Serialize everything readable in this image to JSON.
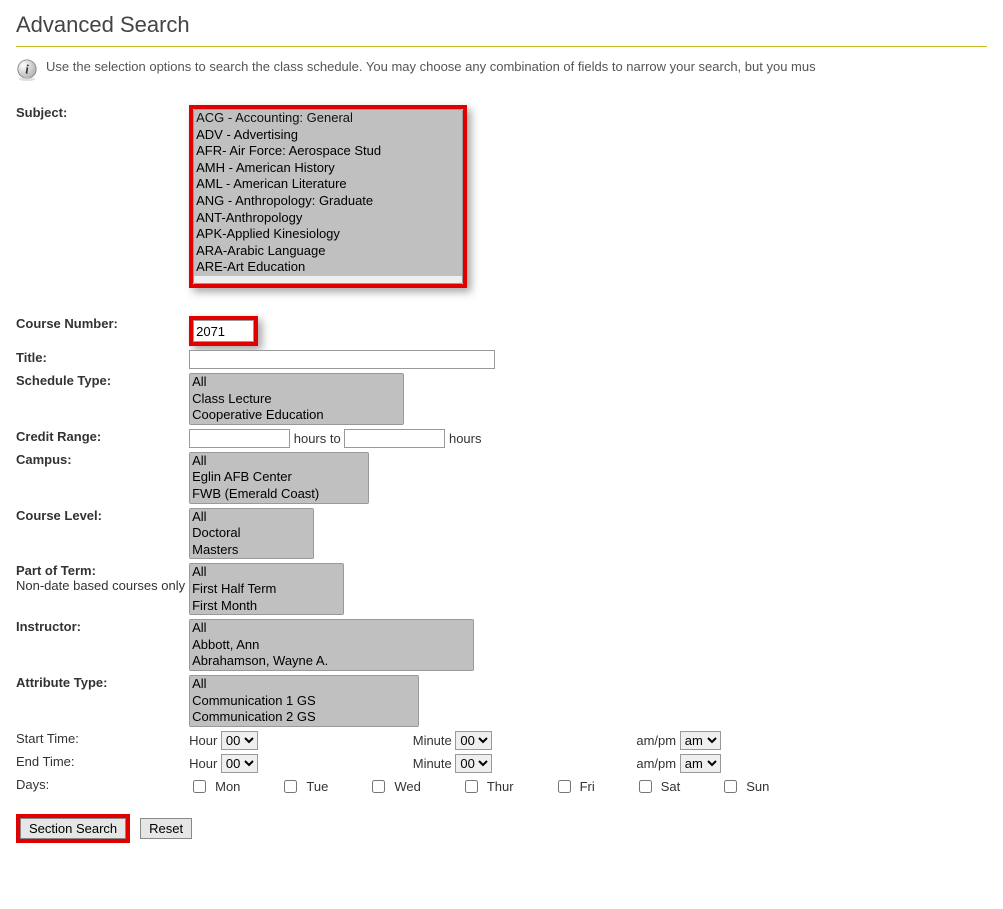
{
  "page": {
    "title": "Advanced Search",
    "info_text": "Use the selection options to search the class schedule. You may choose any combination of fields to narrow your search, but you mus"
  },
  "labels": {
    "subject": "Subject:",
    "course_number": "Course Number:",
    "title": "Title:",
    "schedule_type": "Schedule Type:",
    "credit_range": "Credit Range:",
    "hours_to": "hours to",
    "hours": "hours",
    "campus": "Campus:",
    "course_level": "Course Level:",
    "part_of_term": "Part of Term:",
    "part_of_term_sub": "Non-date based courses only",
    "instructor": "Instructor:",
    "attribute_type": "Attribute Type:",
    "start_time": "Start Time:",
    "end_time": "End Time:",
    "hour": "Hour",
    "minute": "Minute",
    "ampm": "am/pm",
    "days": "Days:"
  },
  "values": {
    "course_number": "2071",
    "title": "",
    "credit_from": "",
    "credit_to": "",
    "start_hour": "00",
    "start_minute": "00",
    "start_ampm": "am",
    "end_hour": "00",
    "end_minute": "00",
    "end_ampm": "am"
  },
  "subject_options": [
    "ACG - Accounting: General",
    "ADV - Advertising",
    "AFR- Air Force: Aerospace Stud",
    "AMH - American History",
    "AML - American Literature",
    "ANG - Anthropology: Graduate",
    "ANT-Anthropology",
    "APK-Applied Kinesiology",
    "ARA-Arabic Language",
    "ARE-Art Education"
  ],
  "subject_selected": "ACG - Accounting: General",
  "schedule_type_options": [
    "All",
    "Class Lecture",
    "Cooperative Education"
  ],
  "campus_options": [
    "All",
    "Eglin AFB Center",
    "FWB (Emerald Coast)"
  ],
  "course_level_options": [
    "All",
    "Doctoral",
    "Masters"
  ],
  "part_of_term_options": [
    "All",
    "First Half Term",
    "First Month"
  ],
  "instructor_options": [
    "All",
    "Abbott, Ann",
    "Abrahamson, Wayne A."
  ],
  "attribute_type_options": [
    "All",
    "Communication 1 GS",
    "Communication 2 GS"
  ],
  "day_labels": [
    "Mon",
    "Tue",
    "Wed",
    "Thur",
    "Fri",
    "Sat",
    "Sun"
  ],
  "buttons": {
    "section_search": "Section Search",
    "reset": "Reset"
  }
}
